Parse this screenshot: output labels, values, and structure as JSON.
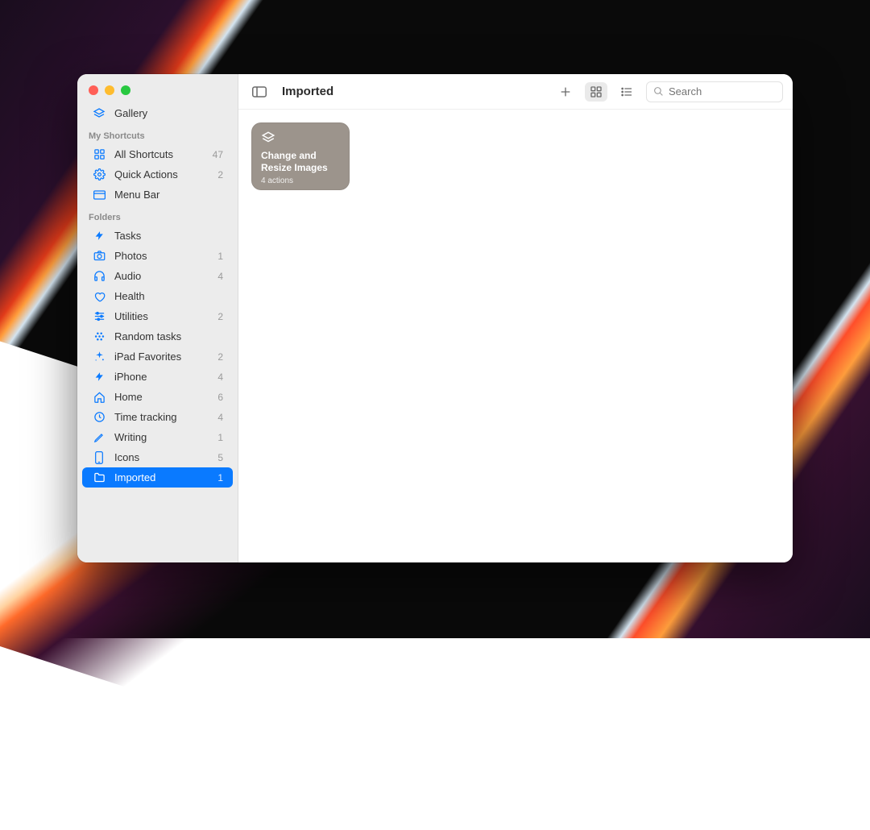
{
  "header": {
    "title": "Imported",
    "search_placeholder": "Search"
  },
  "sidebar": {
    "gallery_label": "Gallery",
    "sections": {
      "my_shortcuts": "My Shortcuts",
      "folders": "Folders"
    },
    "my_shortcuts": [
      {
        "icon": "grid-icon",
        "label": "All Shortcuts",
        "count": "47"
      },
      {
        "icon": "gear-icon",
        "label": "Quick Actions",
        "count": "2"
      },
      {
        "icon": "window-icon",
        "label": "Menu Bar",
        "count": ""
      }
    ],
    "folders": [
      {
        "icon": "bolt-icon",
        "label": "Tasks",
        "count": ""
      },
      {
        "icon": "camera-icon",
        "label": "Photos",
        "count": "1"
      },
      {
        "icon": "headphones-icon",
        "label": "Audio",
        "count": "4"
      },
      {
        "icon": "heart-icon",
        "label": "Health",
        "count": ""
      },
      {
        "icon": "sliders-icon",
        "label": "Utilities",
        "count": "2"
      },
      {
        "icon": "dots-icon",
        "label": "Random tasks",
        "count": ""
      },
      {
        "icon": "sparkle-icon",
        "label": "iPad Favorites",
        "count": "2"
      },
      {
        "icon": "bolt-icon",
        "label": "iPhone",
        "count": "4"
      },
      {
        "icon": "home-icon",
        "label": "Home",
        "count": "6"
      },
      {
        "icon": "clock-icon",
        "label": "Time tracking",
        "count": "4"
      },
      {
        "icon": "pencil-icon",
        "label": "Writing",
        "count": "1"
      },
      {
        "icon": "phone-icon",
        "label": "Icons",
        "count": "5"
      },
      {
        "icon": "folder-icon",
        "label": "Imported",
        "count": "1",
        "selected": true
      }
    ]
  },
  "shortcuts": [
    {
      "title": "Change and Resize Images",
      "subtitle": "4 actions",
      "color": "#9c948c",
      "icon": "layers-icon"
    }
  ]
}
